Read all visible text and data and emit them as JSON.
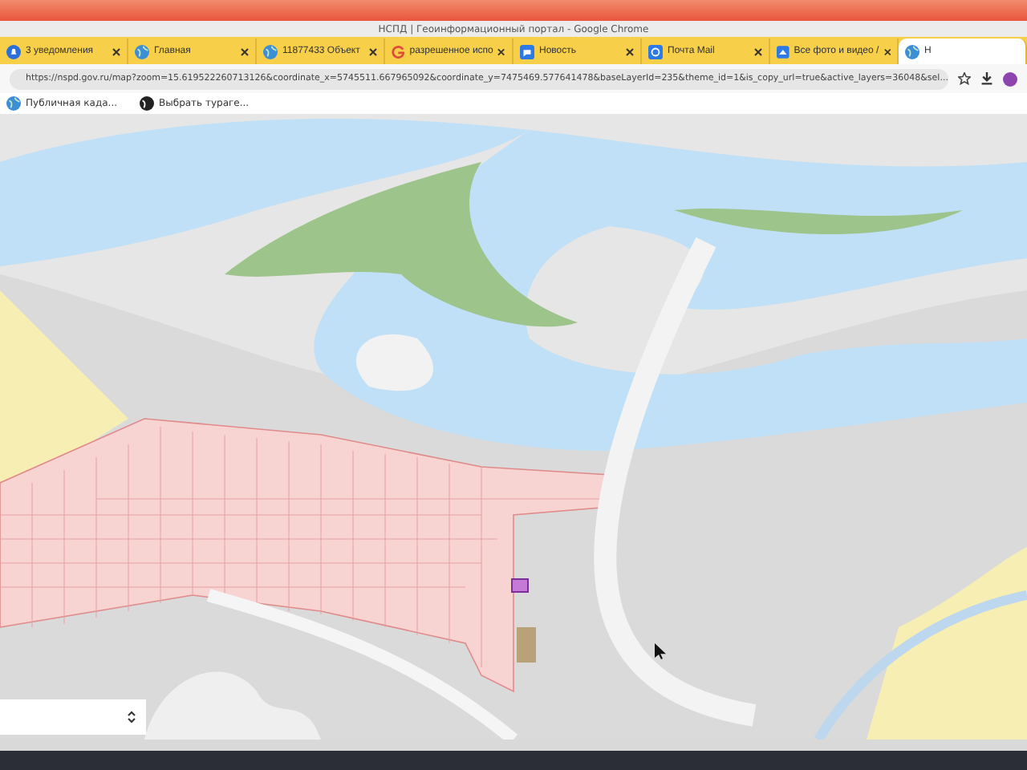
{
  "window": {
    "title": "НСПД | Геоинформационный портал - Google Chrome"
  },
  "tabs": [
    {
      "label": "3 уведомления",
      "kind": "bell",
      "selected": false
    },
    {
      "label": "Главная",
      "kind": "globe",
      "selected": false
    },
    {
      "label": "11877433 Объект",
      "kind": "globe",
      "selected": false
    },
    {
      "label": "разрешенное испо",
      "kind": "google",
      "selected": false
    },
    {
      "label": "Новость",
      "kind": "news",
      "selected": false
    },
    {
      "label": "Почта Mail",
      "kind": "mail",
      "selected": false
    },
    {
      "label": "Все фото и видео /",
      "kind": "photo",
      "selected": false
    },
    {
      "label": "Н",
      "kind": "globe",
      "selected": true
    }
  ],
  "address_bar": {
    "url": "https://nspd.gov.ru/map?zoom=15.619522260713126&coordinate_x=5745511.667965092&coordinate_y=7475469.577641478&baseLayerId=235&theme_id=1&is_copy_url=true&active_layers=36048&sel..."
  },
  "bookmarks": [
    {
      "label": "Публичная када...",
      "kind": "globe"
    },
    {
      "label": "Выбрать тураге...",
      "kind": "dark"
    }
  ]
}
